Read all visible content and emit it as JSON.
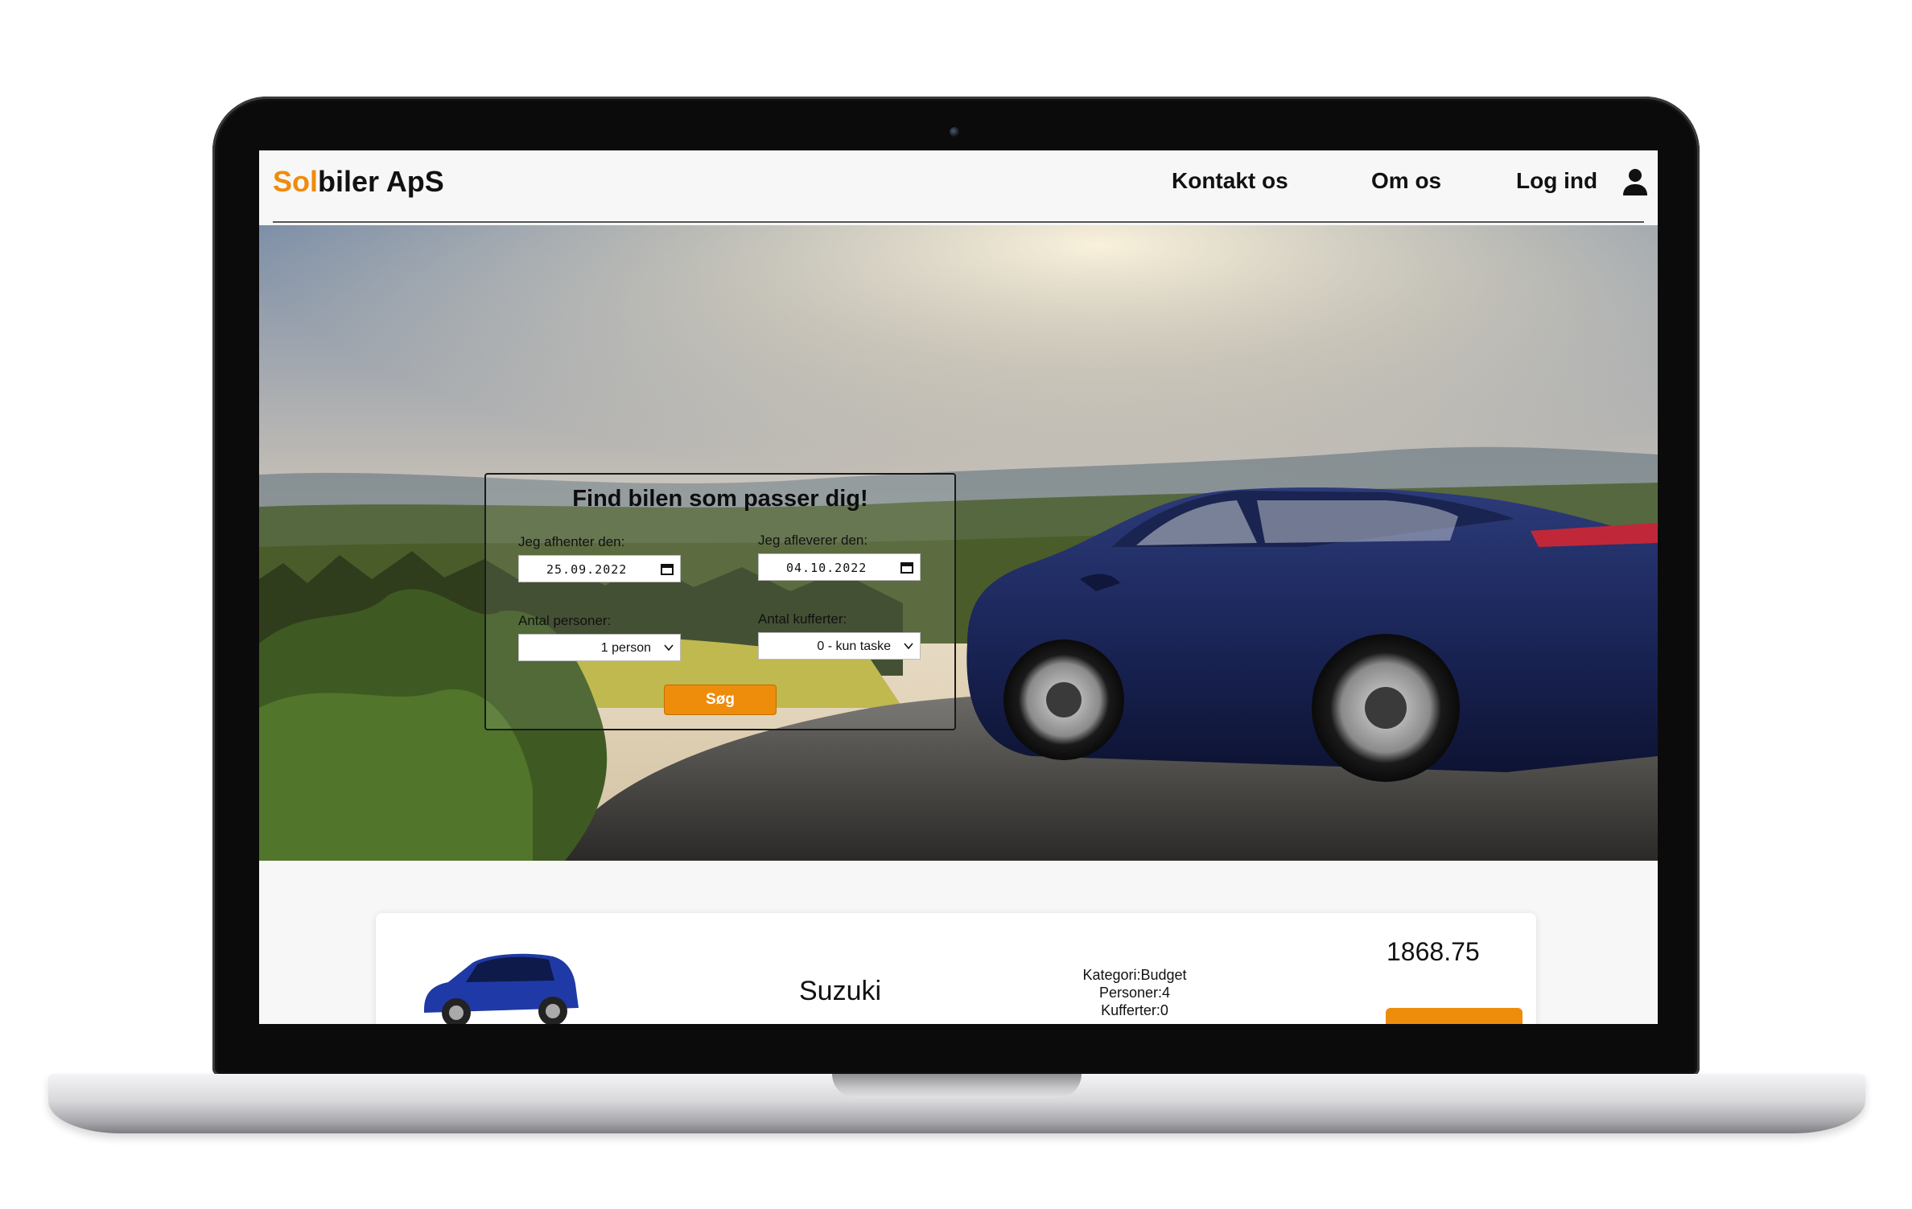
{
  "header": {
    "logo_accent": "Sol",
    "logo_rest": "biler ApS",
    "nav": {
      "contact": "Kontakt os",
      "about": "Om os",
      "login": "Log ind"
    }
  },
  "search": {
    "title": "Find bilen som passer dig!",
    "pickup_label": "Jeg afhenter den:",
    "pickup_value": "25.09.2022",
    "return_label": "Jeg afleverer den:",
    "return_value": "04.10.2022",
    "persons_label": "Antal personer:",
    "persons_value": "1 person",
    "suitcases_label": "Antal kufferter:",
    "suitcases_value": "0 - kun taske",
    "button_label": "Søg"
  },
  "results": [
    {
      "name": "Suzuki",
      "category": "Kategori:Budget",
      "persons": "Personer:4",
      "suitcases": "Kufferter:0",
      "price": "1868.75"
    }
  ],
  "icons": {
    "user": "user-icon",
    "calendar": "calendar-icon",
    "chevron": "chevron-down-icon"
  },
  "colors": {
    "accent": "#ee8c0c",
    "text": "#111111",
    "car_blue": "#1d2b63"
  }
}
